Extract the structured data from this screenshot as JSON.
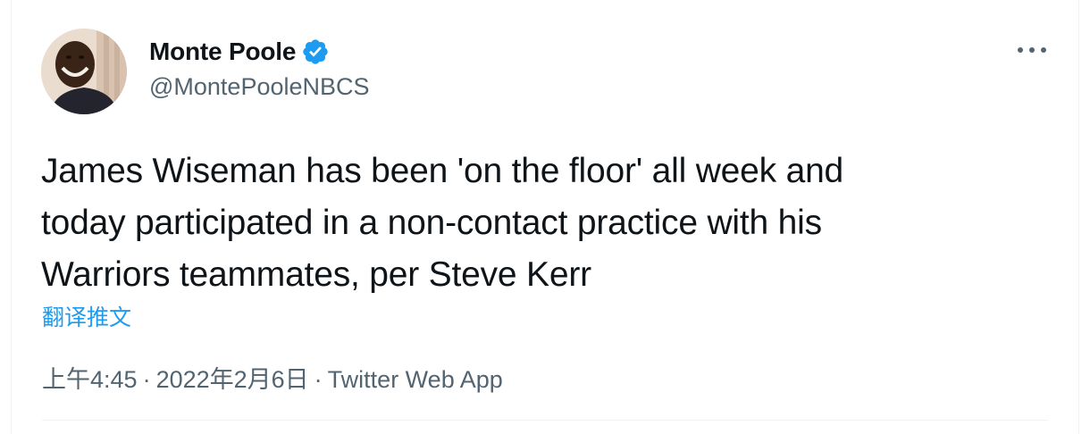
{
  "tweet": {
    "author": {
      "display_name": "Monte Poole",
      "handle": "@MontePooleNBCS",
      "verified": true
    },
    "text_lines": [
      "James Wiseman has been 'on the floor' all week and",
      "today participated in a non-contact practice with his",
      "Warriors teammates, per Steve Kerr"
    ],
    "translate_label": "翻译推文",
    "time": "上午4:45",
    "separator": "·",
    "date": "2022年2月6日",
    "source": "Twitter Web App"
  },
  "colors": {
    "text": "#0f1419",
    "secondary": "#536471",
    "accent": "#1d9bf0",
    "border": "#eff3f4"
  },
  "icons": {
    "verified": "verified-badge-icon",
    "more": "more-options-icon"
  }
}
